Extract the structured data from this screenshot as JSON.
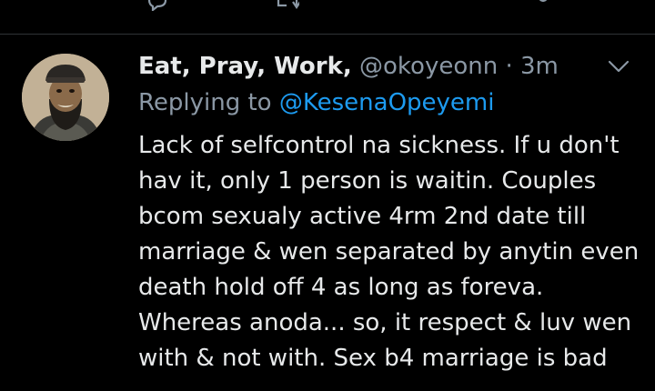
{
  "previous_tweet": {
    "actions": [
      {
        "name": "reply",
        "icon": "reply-icon"
      },
      {
        "name": "retweet",
        "icon": "retweet-icon"
      },
      {
        "name": "share",
        "icon": "share-icon"
      }
    ]
  },
  "tweet": {
    "display_name": "Eat, Pray, Work,",
    "handle": "@okoyeonn",
    "separator": "·",
    "time": "3m",
    "more_icon": "chevron-down-icon",
    "reply_prefix": "Replying to",
    "reply_to": "@KesenaOpeyemi",
    "body_lines": [
      "Lack of selfcontrol na sickness. If u don't",
      "hav it, only 1 person is waitin. Couples",
      "bcom sexualy active 4rm 2nd date till",
      "marriage & wen separated by anytin even",
      "death hold off 4 as long as foreva.",
      "Whereas anoda... so, it respect & luv wen",
      "with & not with. Sex b4 marriage is bad"
    ]
  },
  "colors": {
    "background": "#000000",
    "text_primary": "#e7e9ea",
    "text_secondary": "#8b98a5",
    "link": "#1d9bf0",
    "divider": "#2f3336"
  }
}
